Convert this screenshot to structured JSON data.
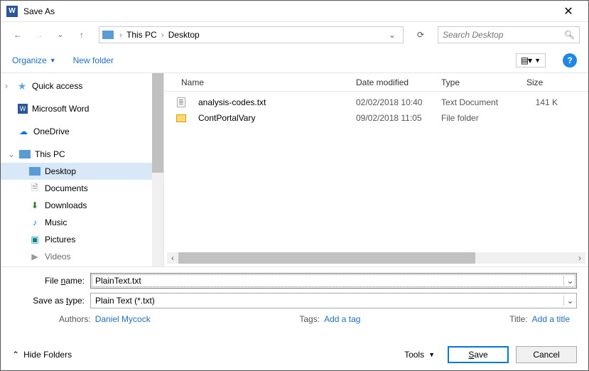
{
  "titlebar": {
    "title": "Save As"
  },
  "nav": {
    "breadcrumb": [
      "This PC",
      "Desktop"
    ],
    "search_placeholder": "Search Desktop"
  },
  "toolbar": {
    "organize": "Organize",
    "new_folder": "New folder"
  },
  "sidebar": {
    "quick_access": "Quick access",
    "word": "Microsoft Word",
    "onedrive": "OneDrive",
    "this_pc": "This PC",
    "desktop": "Desktop",
    "documents": "Documents",
    "downloads": "Downloads",
    "music": "Music",
    "pictures": "Pictures",
    "videos": "Videos"
  },
  "columns": {
    "name": "Name",
    "date": "Date modified",
    "type": "Type",
    "size": "Size"
  },
  "files": [
    {
      "name": "analysis-codes.txt",
      "date": "02/02/2018 10:40",
      "type": "Text Document",
      "size": "141 K",
      "kind": "txt"
    },
    {
      "name": "ContPortalVary",
      "date": "09/02/2018 11:05",
      "type": "File folder",
      "size": "",
      "kind": "folder"
    }
  ],
  "form": {
    "filename_label": "File name:",
    "filename_value": "PlainText.txt",
    "type_label": "Save as type:",
    "type_value": "Plain Text (*.txt)",
    "authors_label": "Authors:",
    "authors_value": "Daniel Mycock",
    "tags_label": "Tags:",
    "tags_value": "Add a tag",
    "title_label": "Title:",
    "title_value": "Add a title"
  },
  "footer": {
    "hide_folders": "Hide Folders",
    "tools": "Tools",
    "save": "Save",
    "cancel": "Cancel"
  }
}
